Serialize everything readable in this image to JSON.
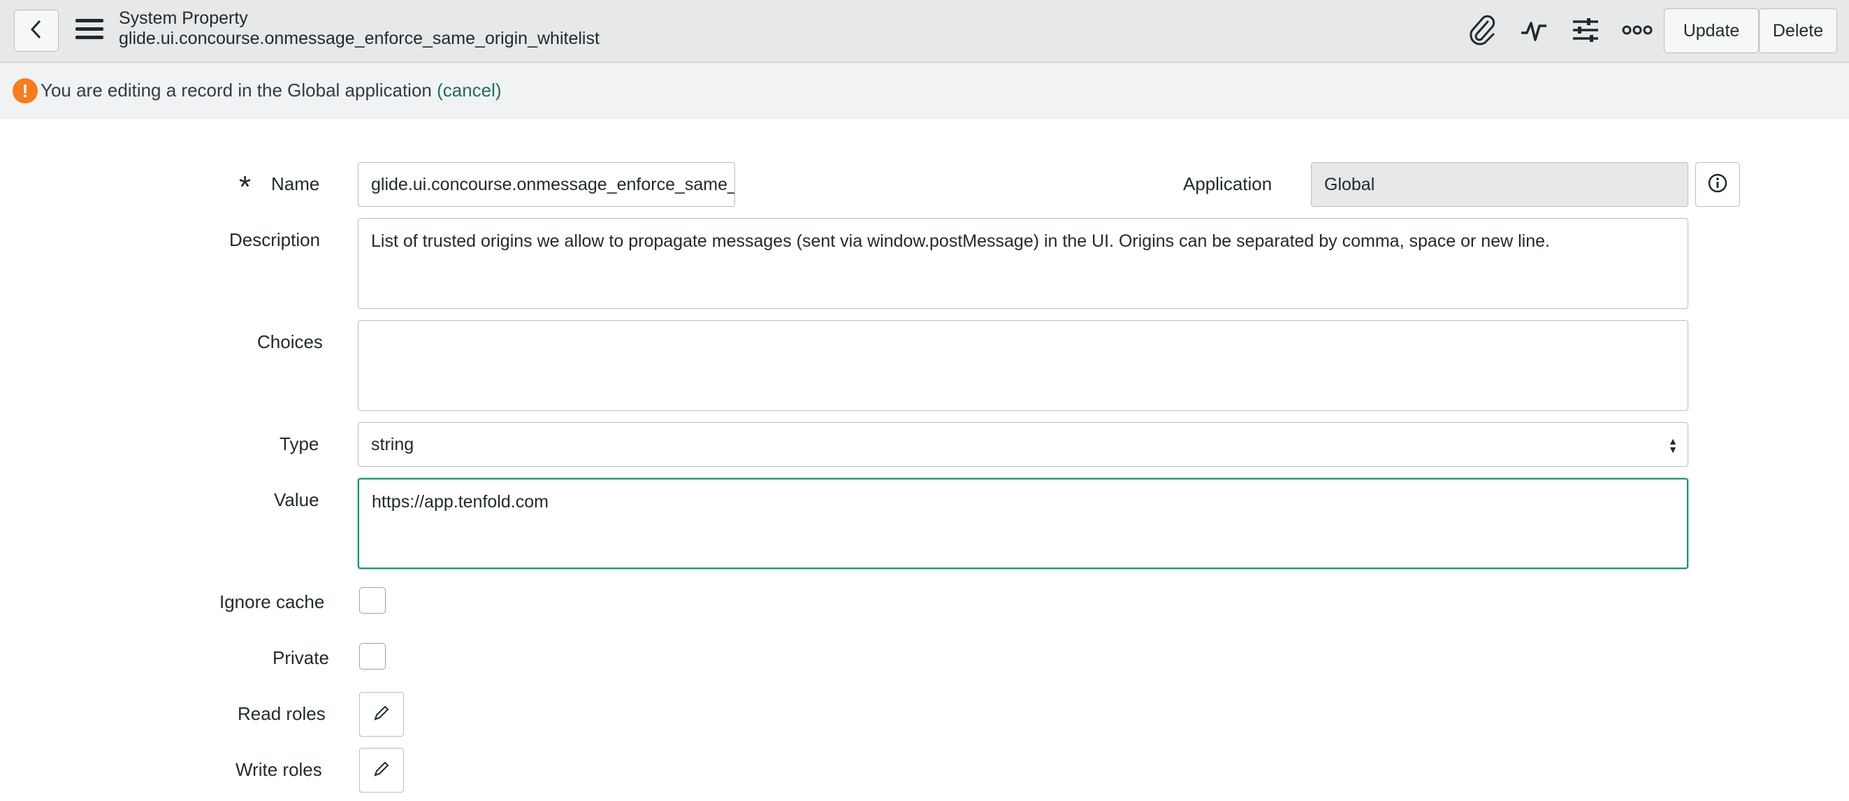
{
  "header": {
    "title": "System Property",
    "record_name": "glide.ui.concourse.onmessage_enforce_same_origin_whitelist",
    "update_label": "Update",
    "delete_label": "Delete",
    "icons": [
      "back-icon",
      "menu-icon",
      "paperclip-icon",
      "activity-icon",
      "settings-sliders-icon",
      "more-icon"
    ]
  },
  "banner": {
    "text_before": "You are editing a record in the ",
    "app": "Global",
    "text_after": " application ",
    "cancel_link": "(cancel)"
  },
  "form": {
    "name": {
      "label": "Name",
      "value": "glide.ui.concourse.onmessage_enforce_same_"
    },
    "application": {
      "label": "Application",
      "value": "Global"
    },
    "description": {
      "label": "Description",
      "value": "List of trusted origins we allow to propagate messages (sent via window.postMessage) in the UI. Origins can be separated by comma, space or new line."
    },
    "choices": {
      "label": "Choices",
      "value": ""
    },
    "type": {
      "label": "Type",
      "value": "string"
    },
    "value": {
      "label": "Value",
      "value": "https://app.tenfold.com"
    },
    "ignore_cache": {
      "label": "Ignore cache",
      "checked": false
    },
    "private": {
      "label": "Private",
      "checked": false
    },
    "read_roles": {
      "label": "Read roles"
    },
    "write_roles": {
      "label": "Write roles"
    }
  },
  "colors": {
    "header_bg": "#e6e8ea",
    "banner_bg": "#f1f2f3",
    "warning": "#f57c1f",
    "focus_accent": "#1d8a78",
    "link": "#1d6e5d"
  }
}
